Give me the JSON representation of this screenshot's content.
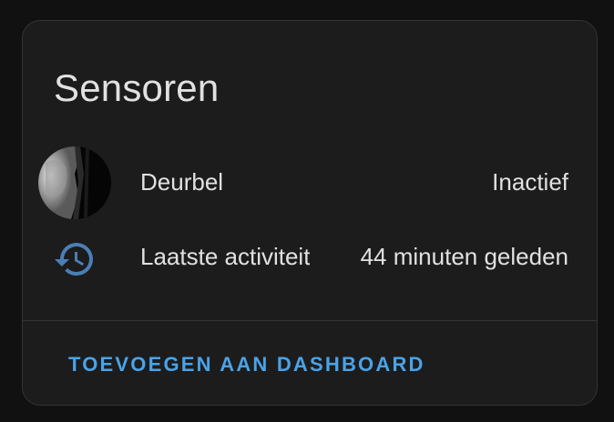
{
  "card": {
    "title": "Sensoren"
  },
  "rows": [
    {
      "label": "Deurbel",
      "value": "Inactief",
      "icon": "doorbell-camera-thumbnail"
    },
    {
      "label": "Laatste activiteit",
      "value": "44 minuten geleden",
      "icon": "history-icon"
    }
  ],
  "actions": {
    "add_to_dashboard_label": "TOEVOEGEN AAN DASHBOARD"
  },
  "colors": {
    "background": "#111111",
    "card": "#1c1c1c",
    "text": "#e1e1e1",
    "accent": "#4aa3e8",
    "icon": "#4a7fb5"
  }
}
